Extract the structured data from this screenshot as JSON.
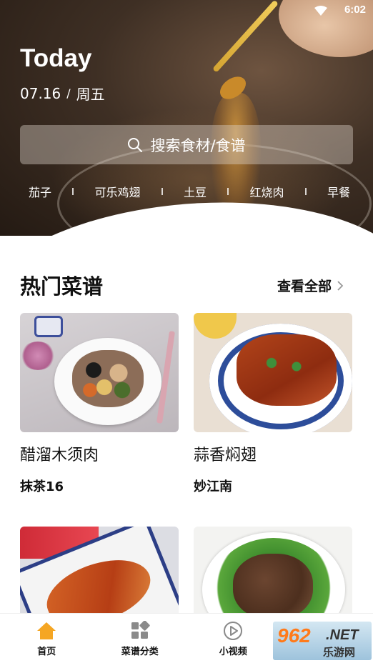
{
  "status_bar": {
    "time": "6:02"
  },
  "hero": {
    "title": "Today",
    "date": "07.16",
    "date_separator": "/",
    "weekday": "周五",
    "search_placeholder": "搜索食材/食谱",
    "tags": [
      "茄子",
      "可乐鸡翅",
      "土豆",
      "红烧肉",
      "早餐"
    ]
  },
  "popular": {
    "title": "热门菜谱",
    "view_all": "查看全部",
    "recipes": [
      {
        "name": "醋溜木须肉",
        "author": "抹茶16"
      },
      {
        "name": "蒜香焖翅",
        "author": "妙江南"
      },
      {
        "name": "",
        "author": ""
      },
      {
        "name": "",
        "author": ""
      }
    ]
  },
  "bottom_nav": {
    "items": [
      {
        "label": "首页",
        "icon": "home-icon",
        "active": true
      },
      {
        "label": "菜谱分类",
        "icon": "category-grid-icon",
        "active": false
      },
      {
        "label": "小视频",
        "icon": "play-video-icon",
        "active": false
      },
      {
        "label": "",
        "icon": "profile-icon",
        "active": false
      }
    ]
  },
  "watermark": {
    "number": "962",
    "suffix": ".NET",
    "sub": "乐游网"
  },
  "colors": {
    "accent": "#f5a623",
    "text": "#111111",
    "search_bg": "rgba(220,210,200,0.42)"
  }
}
